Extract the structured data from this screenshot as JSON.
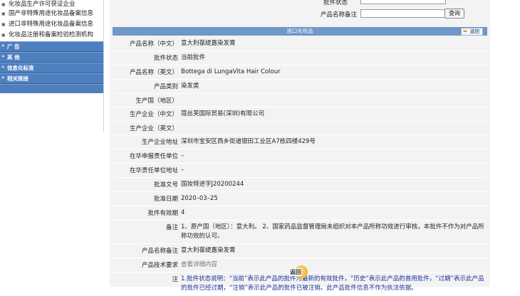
{
  "sidebar": {
    "items": [
      {
        "label": "化妆品生产许可获证企业"
      },
      {
        "label": "国产非特殊用途化妆品备案信息"
      },
      {
        "label": "进口非特殊用途化妆品备案信息"
      },
      {
        "label": "化妆品注册和备案检验检测机构"
      }
    ],
    "sections": [
      {
        "label": "广 告"
      },
      {
        "label": "其 他"
      },
      {
        "label": "信息化标准"
      },
      {
        "label": "相关链接"
      }
    ]
  },
  "search": {
    "status_label": "批件状态",
    "remark_label": "产品名称备注",
    "query_button": "查询"
  },
  "panel": {
    "title": "进口化妆品",
    "back_label": "返回"
  },
  "details": [
    {
      "label": "产品名称（中文）",
      "value": "意大利葆缇嘉染发膏"
    },
    {
      "label": "批件状态",
      "value": "当前批件"
    },
    {
      "label": "产品名称（英文）",
      "value": "Bottega di LungaVita Hair Colour"
    },
    {
      "label": "产品类别",
      "value": "染发类"
    },
    {
      "label": "生产国（地区）",
      "value": ""
    },
    {
      "label": "生产企业（中文）",
      "value": "蔻丝芙国际贸易(深圳)有限公司"
    },
    {
      "label": "生产企业（英文）",
      "value": ""
    },
    {
      "label": "生产企业地址",
      "value": "深圳市宝安区西乡街道银田工业区A7栋四楼429号"
    },
    {
      "label": "在华申报责任单位",
      "value": "–"
    },
    {
      "label": "在华责任单位地址",
      "value": "–"
    },
    {
      "label": "批准文号",
      "value": "国妆特进字J20200244"
    },
    {
      "label": "批准日期",
      "value": "2020–03–25"
    },
    {
      "label": "批件有效期",
      "value": "4"
    },
    {
      "label": "备注",
      "value": "1、原产国（地区）：意大利。 2、国家药品监督管理局未组织对本产品所称功效进行审核，本批件不作为对产品所称功效的认可。"
    },
    {
      "label": "产品名称备注",
      "value": "意大利葆缇嘉染发膏"
    },
    {
      "label": "产品技术要求",
      "value": "查看详细内容"
    },
    {
      "label": "注",
      "value": "1.批件状态说明：“当前”表示此产品的批件为最新的有效批件，“历史”表示此产品的曾用批件，“过期”表示此产品的批件已经过期，“注销”表示此产品的批件已被注销。此产品批件信息不作为执法依据。"
    }
  ],
  "bottom": {
    "back_label": "返回"
  }
}
